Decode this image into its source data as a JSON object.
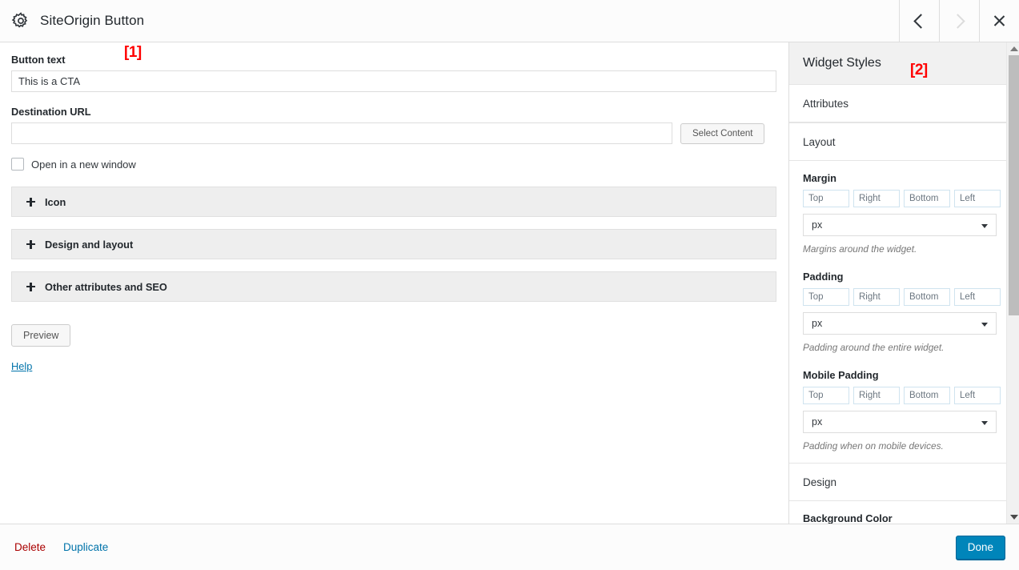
{
  "titlebar": {
    "icon": "gear-icon",
    "title": "SiteOrigin Button",
    "prev_label": "‹",
    "next_label": "›",
    "close_label": "×"
  },
  "annotations": [
    {
      "id": "1",
      "label": "[1]",
      "color": "#ff0000",
      "target": "main form panel"
    },
    {
      "id": "2",
      "label": "[2]",
      "color": "#ff0000",
      "target": "widget styles panel"
    }
  ],
  "main": {
    "button_text": {
      "label": "Button text",
      "value": "This is a CTA",
      "placeholder": ""
    },
    "destination_url": {
      "label": "Destination URL",
      "value": "",
      "placeholder": "",
      "select_content_label": "Select Content"
    },
    "new_window": {
      "label": "Open in a new window",
      "checked": false
    },
    "sections": [
      {
        "label": "Icon",
        "expander": "+",
        "expanded": false
      },
      {
        "label": "Design and layout",
        "expander": "+",
        "expanded": false
      },
      {
        "label": "Other attributes and SEO",
        "expander": "+",
        "expanded": false
      }
    ],
    "preview_label": "Preview",
    "help_label": "Help"
  },
  "sidebar": {
    "title": "Widget Styles",
    "sections": [
      {
        "label": "Attributes"
      },
      {
        "label": "Layout"
      }
    ],
    "design_section": {
      "label": "Design"
    },
    "background_color_label": "Background Color",
    "groups": [
      {
        "label": "Margin",
        "fields": [
          {
            "placeholder": "Top",
            "value": ""
          },
          {
            "placeholder": "Right",
            "value": ""
          },
          {
            "placeholder": "Bottom",
            "value": ""
          },
          {
            "placeholder": "Left",
            "value": ""
          }
        ],
        "unit": "px",
        "hint": "Margins around the widget."
      },
      {
        "label": "Padding",
        "fields": [
          {
            "placeholder": "Top",
            "value": ""
          },
          {
            "placeholder": "Right",
            "value": ""
          },
          {
            "placeholder": "Bottom",
            "value": ""
          },
          {
            "placeholder": "Left",
            "value": ""
          }
        ],
        "unit": "px",
        "hint": "Padding around the entire widget."
      },
      {
        "label": "Mobile Padding",
        "fields": [
          {
            "placeholder": "Top",
            "value": ""
          },
          {
            "placeholder": "Right",
            "value": ""
          },
          {
            "placeholder": "Bottom",
            "value": ""
          },
          {
            "placeholder": "Left",
            "value": ""
          }
        ],
        "unit": "px",
        "hint": "Padding when on mobile devices."
      }
    ]
  },
  "footer": {
    "delete_label": "Delete",
    "duplicate_label": "Duplicate",
    "done_label": "Done"
  },
  "colors": {
    "accent": "#0085ba",
    "link": "#0073aa",
    "delete": "#a00000",
    "annotation": "#ff0000",
    "panel_bg": "#f1f1f1",
    "accordion_bg": "#eeeeee"
  }
}
